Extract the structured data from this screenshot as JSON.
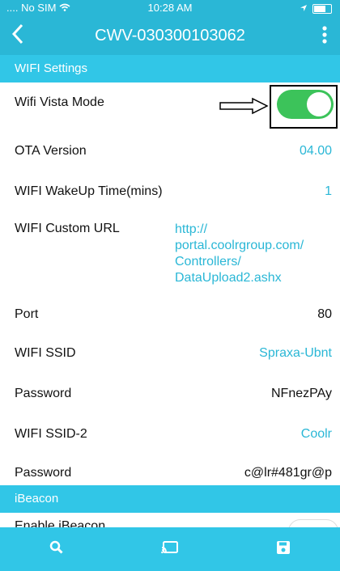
{
  "status_bar": {
    "carrier": "No SIM",
    "time": "10:28 AM"
  },
  "header": {
    "title": "CWV-030300103062"
  },
  "sections": {
    "wifi_settings": "WIFI Settings",
    "ibeacon": "iBeacon"
  },
  "rows": {
    "wifi_vista_mode": {
      "label": "Wifi Vista Mode",
      "on": true
    },
    "ota_version": {
      "label": "OTA Version",
      "value": "04.00"
    },
    "wakeup_time": {
      "label": "WIFI WakeUp Time(mins)",
      "value": "1"
    },
    "custom_url": {
      "label": "WIFI Custom URL",
      "lines": [
        "http://",
        "portal.coolrgroup.com/",
        "Controllers/",
        "DataUpload2.ashx"
      ]
    },
    "port": {
      "label": "Port",
      "value": "80"
    },
    "ssid": {
      "label": "WIFI SSID",
      "value": "Spraxa-Ubnt"
    },
    "password": {
      "label": "Password",
      "value": "NFnezPAy"
    },
    "ssid2": {
      "label": "WIFI SSID-2",
      "value": "Coolr"
    },
    "password2": {
      "label": "Password",
      "value": "c@lr#481gr@p"
    },
    "enable_ibeacon": {
      "label": "Enable iBeacon"
    }
  },
  "tabbar": {
    "items": [
      "search-icon",
      "cast-icon",
      "save-icon"
    ]
  },
  "colors": {
    "primary": "#2ab7d6",
    "section": "#31c6e7",
    "toggle_on": "#3cc35a"
  }
}
